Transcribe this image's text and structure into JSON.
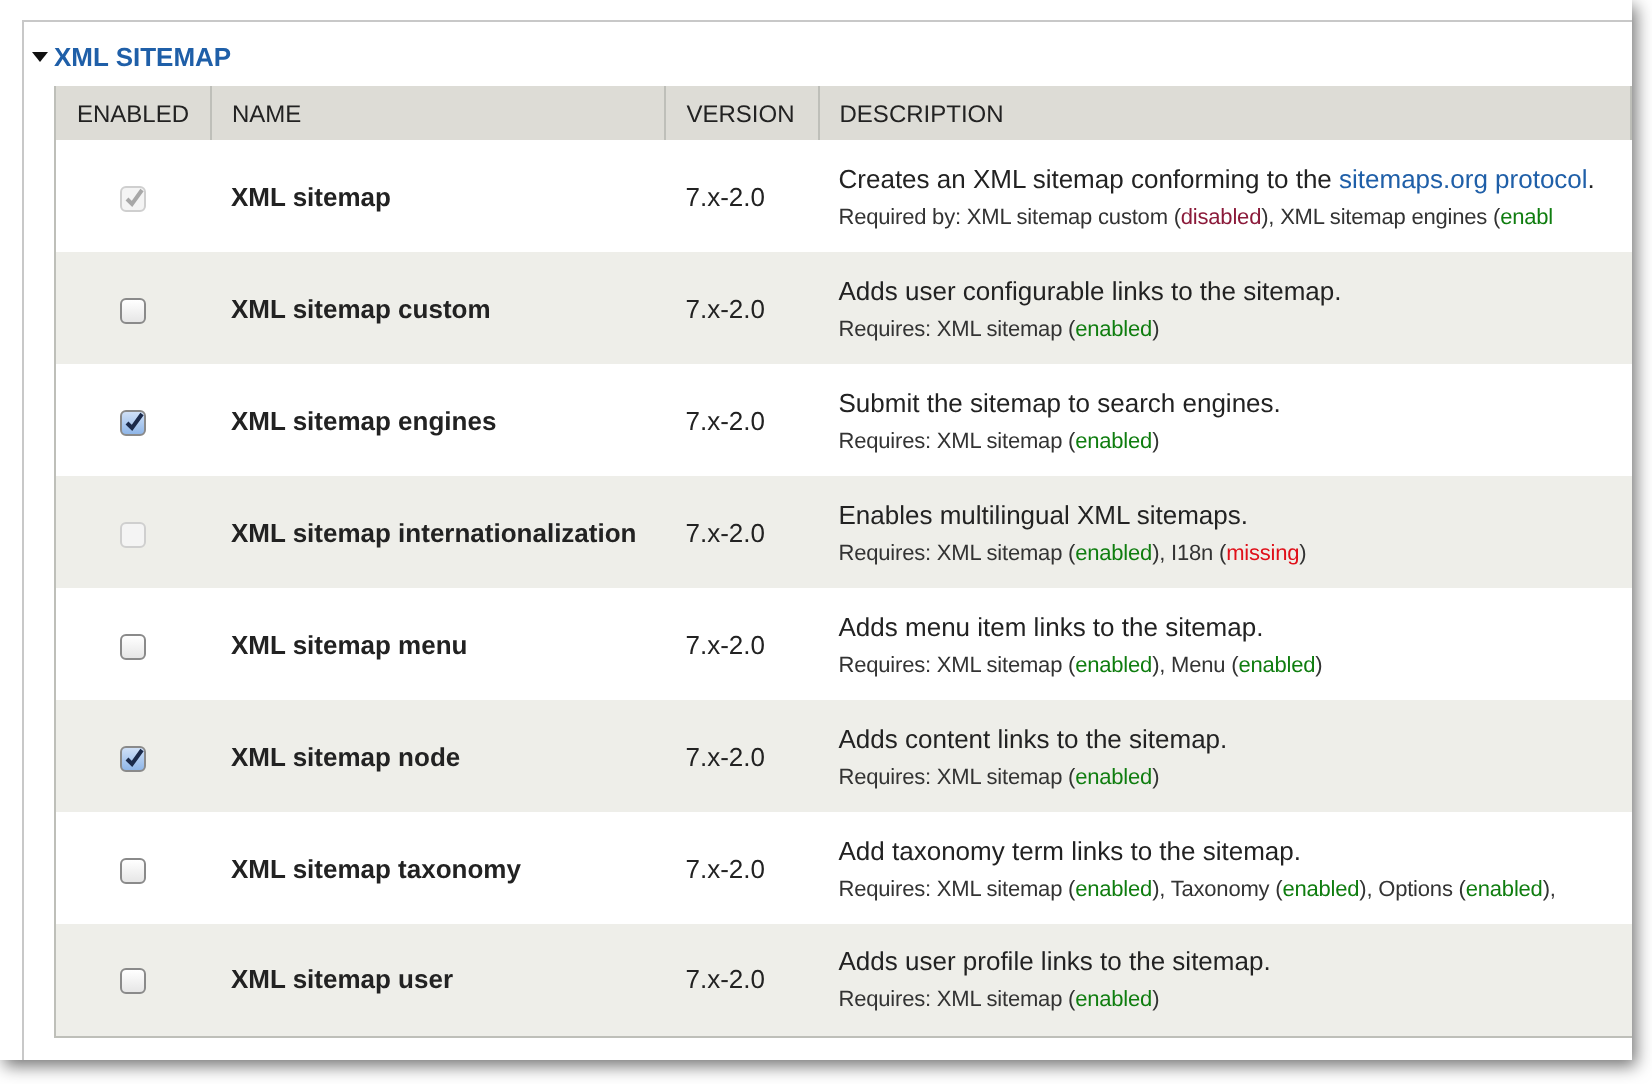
{
  "fieldset": {
    "title": "XML SITEMAP",
    "expanded": true
  },
  "table": {
    "columns": [
      "ENABLED",
      "NAME",
      "VERSION",
      "DESCRIPTION"
    ],
    "rows": [
      {
        "checked": true,
        "disabled": true,
        "name": "XML sitemap",
        "version": "7.x-2.0",
        "description": [
          {
            "text": "Creates an XML sitemap conforming to the "
          },
          {
            "text": "sitemaps.org protocol",
            "kind": "link"
          },
          {
            "text": "."
          }
        ],
        "requirements": [
          {
            "text": "Required by: XML sitemap custom ("
          },
          {
            "text": "disabled",
            "kind": "disabled"
          },
          {
            "text": "), XML sitemap engines ("
          },
          {
            "text": "enabl",
            "kind": "enabled"
          }
        ]
      },
      {
        "checked": false,
        "disabled": false,
        "name": "XML sitemap custom",
        "version": "7.x-2.0",
        "description": [
          {
            "text": "Adds user configurable links to the sitemap."
          }
        ],
        "requirements": [
          {
            "text": "Requires: XML sitemap ("
          },
          {
            "text": "enabled",
            "kind": "enabled"
          },
          {
            "text": ")"
          }
        ]
      },
      {
        "checked": true,
        "disabled": false,
        "name": "XML sitemap engines",
        "version": "7.x-2.0",
        "description": [
          {
            "text": "Submit the sitemap to search engines."
          }
        ],
        "requirements": [
          {
            "text": "Requires: XML sitemap ("
          },
          {
            "text": "enabled",
            "kind": "enabled"
          },
          {
            "text": ")"
          }
        ]
      },
      {
        "checked": false,
        "disabled": true,
        "name": "XML sitemap internationalization",
        "version": "7.x-2.0",
        "description": [
          {
            "text": "Enables multilingual XML sitemaps."
          }
        ],
        "requirements": [
          {
            "text": "Requires: XML sitemap ("
          },
          {
            "text": "enabled",
            "kind": "enabled"
          },
          {
            "text": "), I18n ("
          },
          {
            "text": "missing",
            "kind": "missing"
          },
          {
            "text": ")"
          }
        ]
      },
      {
        "checked": false,
        "disabled": false,
        "name": "XML sitemap menu",
        "version": "7.x-2.0",
        "description": [
          {
            "text": "Adds menu item links to the sitemap."
          }
        ],
        "requirements": [
          {
            "text": "Requires: XML sitemap ("
          },
          {
            "text": "enabled",
            "kind": "enabled"
          },
          {
            "text": "), Menu ("
          },
          {
            "text": "enabled",
            "kind": "enabled"
          },
          {
            "text": ")"
          }
        ]
      },
      {
        "checked": true,
        "disabled": false,
        "name": "XML sitemap node",
        "version": "7.x-2.0",
        "description": [
          {
            "text": "Adds content links to the sitemap."
          }
        ],
        "requirements": [
          {
            "text": "Requires: XML sitemap ("
          },
          {
            "text": "enabled",
            "kind": "enabled"
          },
          {
            "text": ")"
          }
        ]
      },
      {
        "checked": false,
        "disabled": false,
        "name": "XML sitemap taxonomy",
        "version": "7.x-2.0",
        "description": [
          {
            "text": "Add taxonomy term links to the sitemap."
          }
        ],
        "requirements": [
          {
            "text": "Requires: XML sitemap ("
          },
          {
            "text": "enabled",
            "kind": "enabled"
          },
          {
            "text": "), Taxonomy ("
          },
          {
            "text": "enabled",
            "kind": "enabled"
          },
          {
            "text": "), Options ("
          },
          {
            "text": "enabled",
            "kind": "enabled"
          },
          {
            "text": "),"
          }
        ]
      },
      {
        "checked": false,
        "disabled": false,
        "name": "XML sitemap user",
        "version": "7.x-2.0",
        "description": [
          {
            "text": "Adds user profile links to the sitemap."
          }
        ],
        "requirements": [
          {
            "text": "Requires: XML sitemap ("
          },
          {
            "text": "enabled",
            "kind": "enabled"
          },
          {
            "text": ")"
          }
        ]
      }
    ]
  }
}
